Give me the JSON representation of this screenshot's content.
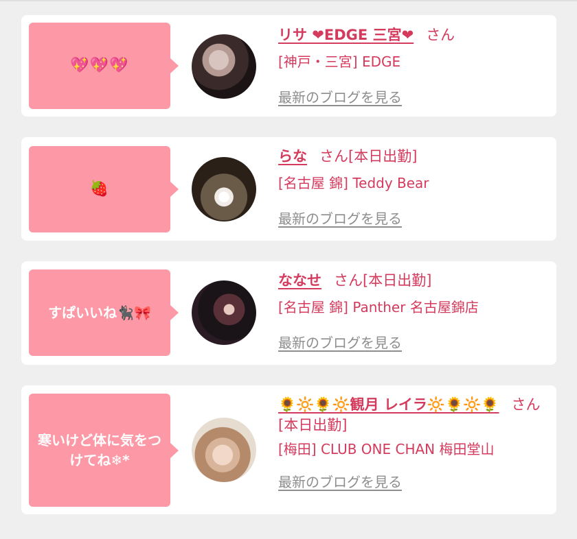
{
  "cards": [
    {
      "message": "💖💖💖",
      "name": "リサ ❤EDGE 三宮❤",
      "san": "さん",
      "status": "",
      "shop": "[神戸・三宮] EDGE",
      "blog_link": "最新のブログを見る"
    },
    {
      "message": "🍓",
      "name": "らな",
      "san": "さん",
      "status": "[本日出勤]",
      "shop": "[名古屋 錦] Teddy Bear",
      "blog_link": "最新のブログを見る"
    },
    {
      "message": "すぱいいね🐈‍⬛🎀",
      "name": "ななせ",
      "san": "さん",
      "status": "[本日出勤]",
      "shop": "[名古屋 錦] Panther 名古屋錦店",
      "blog_link": "最新のブログを見る"
    },
    {
      "message": "寒いけど体に気をつけてね❄*",
      "name": "🌻🔆🌻🔆観月 レイラ🔆🌻🔆🌻",
      "san": "さん",
      "status": "[本日出勤]",
      "shop": "[梅田] CLUB ONE CHAN 梅田堂山",
      "blog_link": "最新のブログを見る"
    }
  ],
  "colors": {
    "accent": "#d43a5c",
    "bubble": "#fd99a6",
    "link_gray": "#8d8d8d",
    "background": "#efefef"
  }
}
